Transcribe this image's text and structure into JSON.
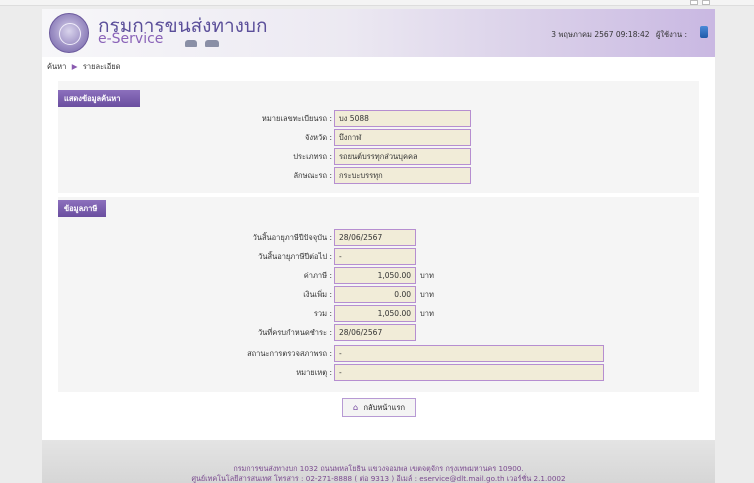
{
  "header": {
    "logo_th": "กรมการขนส่งทางบก",
    "logo_en": "e-Service",
    "datetime": "3 พฤษภาคม 2567 09:18:42",
    "user_label": "ผู้ใช้งาน :"
  },
  "breadcrumb": {
    "search": "ค้นหา",
    "detail": "รายละเอียด"
  },
  "search_section": {
    "title": "แสดงข้อมูลค้นหา",
    "fields": [
      {
        "label": "หมายเลขทะเบียนรถ :",
        "value": "บง 5088"
      },
      {
        "label": "จังหวัด :",
        "value": "บึงกาฬ"
      },
      {
        "label": "ประเภทรถ :",
        "value": "รถยนต์บรรทุกส่วนบุคคล"
      },
      {
        "label": "ลักษณะรถ :",
        "value": "กระบะบรรทุก"
      }
    ]
  },
  "tax_section": {
    "title": "ข้อมูลภาษี",
    "expiry_current": {
      "label": "วันสิ้นอายุภาษีปีปัจจุบัน :",
      "value": "28/06/2567"
    },
    "expiry_next": {
      "label": "วันสิ้นอายุภาษีปีต่อไป :",
      "value": "-"
    },
    "tax": {
      "label": "ค่าภาษี :",
      "value": "1,050.00",
      "unit": "บาท"
    },
    "surcharge": {
      "label": "เงินเพิ่ม :",
      "value": "0.00",
      "unit": "บาท"
    },
    "total": {
      "label": "รวม :",
      "value": "1,050.00",
      "unit": "บาท"
    },
    "due_date": {
      "label": "วันที่ครบกำหนดชำระ :",
      "value": "28/06/2567"
    },
    "inspection": {
      "label": "สถานะการตรวจสภาพรถ :",
      "value": "-"
    },
    "note": {
      "label": "หมายเหตุ :",
      "value": "-"
    }
  },
  "actions": {
    "home_label": "กลับหน้าแรก"
  },
  "footer": {
    "line1": "กรมการขนส่งทางบก 1032 ถนนพหลโยธิน แขวงจอมพล เขตจตุจักร กรุงเทพมหานคร 10900.",
    "line2": "ศูนย์เทคโนโลยีสารสนเทศ โทรสาร : 02-271-8888 ( ต่อ 9313 ) อีเมล์ : eservice@dlt.mail.go.th เวอร์ชั่น 2.1.0002"
  },
  "colors": {
    "accent": "#6a4e9f",
    "field_bg": "#f1ecd8",
    "field_border": "#b68ed0"
  }
}
